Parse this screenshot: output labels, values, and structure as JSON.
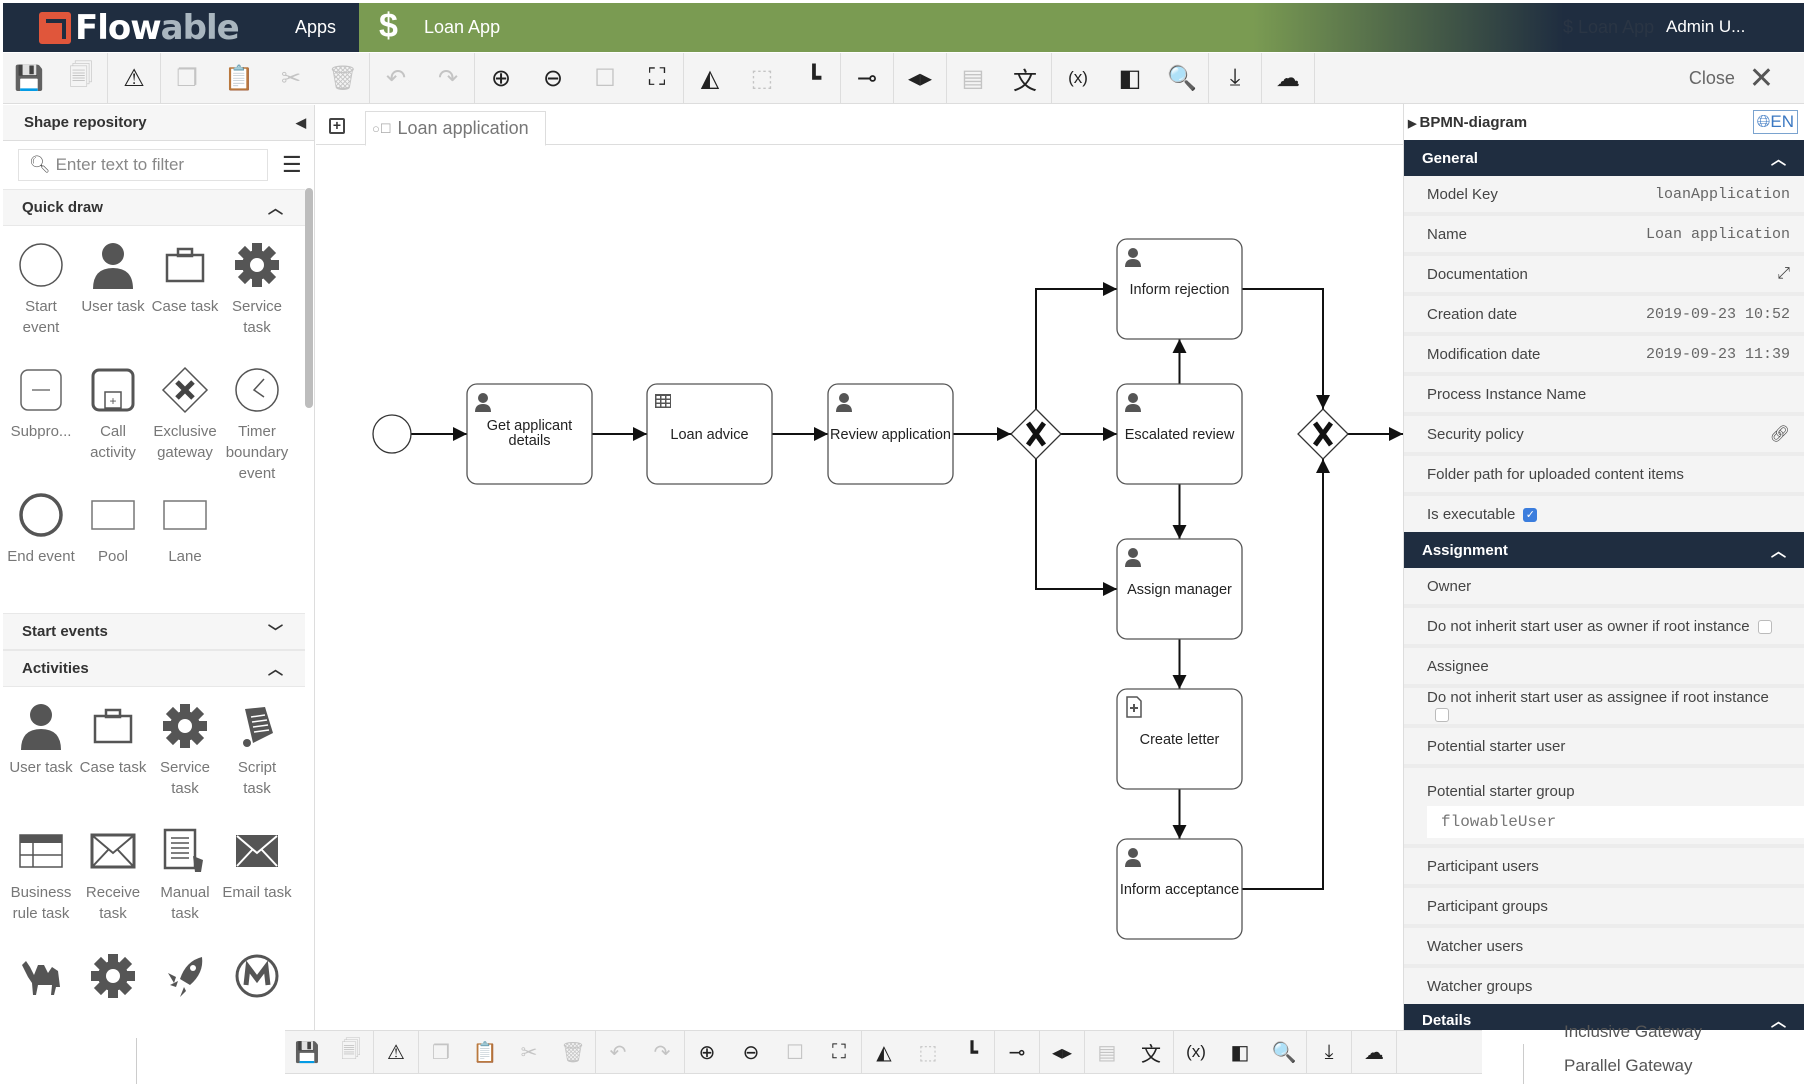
{
  "header": {
    "logo_main": "Flow",
    "logo_accent": "able",
    "apps_label": "Apps",
    "app_icon": "$",
    "app_name": "Loan App",
    "ghost_app": "$ Loan App",
    "user": "Admin U..."
  },
  "toolbar": {
    "items": [
      {
        "icon": "save-icon",
        "glyph": "💾",
        "disabled": true
      },
      {
        "icon": "save-all-icon",
        "glyph": "🗐",
        "disabled": true
      },
      {
        "sep": true
      },
      {
        "icon": "warning-icon",
        "glyph": "⚠",
        "disabled": false
      },
      {
        "sep": true
      },
      {
        "icon": "copy-icon",
        "glyph": "❐",
        "disabled": true
      },
      {
        "icon": "paste-icon",
        "glyph": "📋",
        "disabled": false
      },
      {
        "icon": "cut-icon",
        "glyph": "✂",
        "disabled": true
      },
      {
        "icon": "delete-icon",
        "glyph": "🗑",
        "disabled": true
      },
      {
        "sep": true
      },
      {
        "icon": "undo-icon",
        "glyph": "↶",
        "disabled": true
      },
      {
        "icon": "redo-icon",
        "glyph": "↷",
        "disabled": true
      },
      {
        "sep": true
      },
      {
        "icon": "zoom-in-icon",
        "glyph": "⊕",
        "disabled": false
      },
      {
        "icon": "zoom-out-icon",
        "glyph": "⊖",
        "disabled": false
      },
      {
        "icon": "zoom-actual-icon",
        "glyph": "☐",
        "disabled": true
      },
      {
        "icon": "zoom-fit-icon",
        "glyph": "⛶",
        "disabled": false
      },
      {
        "sep": true
      },
      {
        "icon": "align-vertical-icon",
        "glyph": "◭",
        "disabled": false
      },
      {
        "icon": "align-group-icon",
        "glyph": "⬚",
        "disabled": true
      },
      {
        "icon": "align-bottom-icon",
        "glyph": "┗",
        "disabled": false
      },
      {
        "sep": true
      },
      {
        "icon": "align-middle-icon",
        "glyph": "⊸",
        "disabled": false
      },
      {
        "sep": true
      },
      {
        "icon": "same-size-icon",
        "glyph": "◂▸",
        "disabled": false
      },
      {
        "sep": true
      },
      {
        "icon": "comment-icon",
        "glyph": "▤",
        "disabled": true
      },
      {
        "icon": "translate-icon",
        "glyph": "文",
        "disabled": false
      },
      {
        "sep": true
      },
      {
        "icon": "variables-icon",
        "glyph": "(x)",
        "disabled": false
      },
      {
        "icon": "compare-icon",
        "glyph": "◧",
        "disabled": false
      },
      {
        "icon": "search-text-icon",
        "glyph": "🔍",
        "disabled": false
      },
      {
        "sep": true
      },
      {
        "icon": "download-icon",
        "glyph": "⤓",
        "disabled": false
      },
      {
        "sep": true
      },
      {
        "icon": "publish-cloud-icon",
        "glyph": "☁",
        "disabled": false
      },
      {
        "sep": true
      }
    ],
    "close_label": "Close"
  },
  "shape_repo": {
    "title": "Shape repository",
    "filter_placeholder": "Enter text to filter",
    "quick_draw": {
      "title": "Quick draw",
      "items": [
        {
          "label": "Start event",
          "icon": "start-event-icon"
        },
        {
          "label": "User task",
          "icon": "user-task-icon"
        },
        {
          "label": "Case task",
          "icon": "case-task-icon"
        },
        {
          "label": "Service task",
          "icon": "service-task-icon"
        },
        {
          "label": "Subpro...",
          "icon": "subprocess-icon"
        },
        {
          "label": "Call activity",
          "icon": "call-activity-icon"
        },
        {
          "label": "Exclusive gateway",
          "icon": "exclusive-gateway-icon"
        },
        {
          "label": "Timer boundary event",
          "icon": "timer-boundary-event-icon"
        },
        {
          "label": "End event",
          "icon": "end-event-icon"
        },
        {
          "label": "Pool",
          "icon": "pool-icon"
        },
        {
          "label": "Lane",
          "icon": "lane-icon"
        }
      ]
    },
    "start_events_title": "Start events",
    "activities": {
      "title": "Activities",
      "items": [
        {
          "label": "User task",
          "icon": "user-task-icon"
        },
        {
          "label": "Case task",
          "icon": "case-task-icon"
        },
        {
          "label": "Service task",
          "icon": "service-task-icon"
        },
        {
          "label": "Script task",
          "icon": "script-task-icon"
        },
        {
          "label": "Business rule task",
          "icon": "business-rule-task-icon"
        },
        {
          "label": "Receive task",
          "icon": "receive-task-icon"
        },
        {
          "label": "Manual task",
          "icon": "manual-task-icon"
        },
        {
          "label": "Email task",
          "icon": "email-task-icon"
        },
        {
          "label": "",
          "icon": "camel-task-icon"
        },
        {
          "label": "",
          "icon": "http-task-icon"
        },
        {
          "label": "",
          "icon": "shell-task-icon"
        },
        {
          "label": "",
          "icon": "mule-task-icon"
        }
      ]
    }
  },
  "editor": {
    "tab_label": "Loan application"
  },
  "diagram": {
    "nodes": [
      {
        "id": "start",
        "type": "start-event",
        "label": ""
      },
      {
        "id": "get-applicant",
        "type": "user-task",
        "label": "Get applicant details"
      },
      {
        "id": "loan-advice",
        "type": "business-rule-task",
        "label": "Loan advice"
      },
      {
        "id": "review-application",
        "type": "user-task",
        "label": "Review application"
      },
      {
        "id": "gw1",
        "type": "exclusive-gateway",
        "label": ""
      },
      {
        "id": "inform-rejection",
        "type": "user-task",
        "label": "Inform rejection"
      },
      {
        "id": "escalated-review",
        "type": "user-task",
        "label": "Escalated review"
      },
      {
        "id": "assign-manager",
        "type": "user-task",
        "label": "Assign manager"
      },
      {
        "id": "create-letter",
        "type": "document-task",
        "label": "Create letter"
      },
      {
        "id": "inform-acceptance",
        "type": "user-task",
        "label": "Inform acceptance"
      },
      {
        "id": "gw2",
        "type": "exclusive-gateway",
        "label": ""
      }
    ],
    "flows": [
      [
        "start",
        "get-applicant"
      ],
      [
        "get-applicant",
        "loan-advice"
      ],
      [
        "loan-advice",
        "review-application"
      ],
      [
        "review-application",
        "gw1"
      ],
      [
        "gw1",
        "inform-rejection"
      ],
      [
        "gw1",
        "escalated-review"
      ],
      [
        "gw1",
        "assign-manager"
      ],
      [
        "escalated-review",
        "inform-rejection"
      ],
      [
        "escalated-review",
        "assign-manager"
      ],
      [
        "assign-manager",
        "create-letter"
      ],
      [
        "create-letter",
        "inform-acceptance"
      ],
      [
        "inform-rejection",
        "gw2"
      ],
      [
        "inform-acceptance",
        "gw2"
      ],
      [
        "gw2",
        "out"
      ]
    ]
  },
  "properties": {
    "title": "BPMN-diagram",
    "lang": "EN",
    "general": {
      "title": "General",
      "rows": [
        {
          "label": "Model Key",
          "value": "loanApplication"
        },
        {
          "label": "Name",
          "value": "Loan application"
        },
        {
          "label": "Documentation",
          "value": "",
          "icon": "expand-icon"
        },
        {
          "label": "Creation date",
          "value": "2019-09-23 10:52"
        },
        {
          "label": "Modification date",
          "value": "2019-09-23 11:39"
        },
        {
          "label": "Process Instance Name",
          "value": ""
        },
        {
          "label": "Security policy",
          "value": "",
          "icon": "link-icon"
        },
        {
          "label": "Folder path for uploaded content items",
          "value": ""
        },
        {
          "label": "Is executable",
          "checkbox": true,
          "checked": true
        }
      ]
    },
    "assignment": {
      "title": "Assignment",
      "rows": [
        {
          "label": "Owner"
        },
        {
          "label": "Do not inherit start user as owner if root instance",
          "checkbox": true,
          "checked": false
        },
        {
          "label": "Assignee"
        },
        {
          "label": "Do not inherit start user as assignee if root instance",
          "checkbox": true,
          "checked": false
        },
        {
          "label": "Potential starter user"
        },
        {
          "label": "Potential starter group",
          "block_value": "flowableUser"
        },
        {
          "label": "Participant users"
        },
        {
          "label": "Participant groups"
        },
        {
          "label": "Watcher users"
        },
        {
          "label": "Watcher groups"
        }
      ]
    },
    "details_title": "Details"
  },
  "background_overlay": {
    "items": [
      "Inclusive Gateway",
      "Parallel Gateway"
    ]
  }
}
